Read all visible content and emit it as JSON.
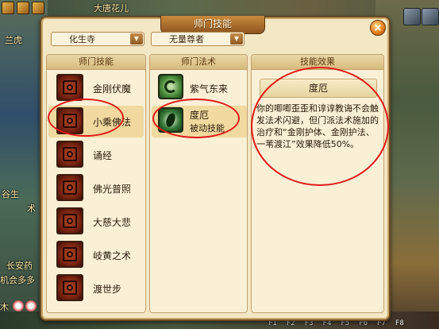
{
  "window": {
    "title": "师门技能",
    "close_symbol": "×"
  },
  "filters": {
    "faction": "化生寺",
    "skill_source": "无量尊者"
  },
  "panels": {
    "skills_header": "师门技能",
    "spells_header": "师门法术",
    "effect_header": "技能效果"
  },
  "skills": [
    {
      "label": "金刚伏魔",
      "selected": false
    },
    {
      "label": "小乘佛法",
      "selected": true
    },
    {
      "label": "诵经",
      "selected": false
    },
    {
      "label": "佛光普照",
      "selected": false
    },
    {
      "label": "大慈大悲",
      "selected": false
    },
    {
      "label": "岐黄之术",
      "selected": false
    },
    {
      "label": "渡世步",
      "selected": false
    }
  ],
  "spells": [
    {
      "label": "紫气东来",
      "sub": "",
      "selected": false
    },
    {
      "label": "度厄",
      "sub": "被动技能",
      "selected": true
    }
  ],
  "effect": {
    "title": "度厄",
    "description": "你的唧唧歪歪和谆谆教诲不会触发法术闪避，但门派法术施加的治疗和“金刚护体、金刚护法、一苇渡江”效果降低50%。"
  },
  "background": {
    "top_text": "大唐花儿",
    "left_texts": [
      "兰虎",
      "谷生",
      "术",
      "长安药",
      "机会多多",
      "木"
    ],
    "function_keys": [
      "F1",
      "F2",
      "F3",
      "F4",
      "F5",
      "F6",
      "F7",
      "F8"
    ]
  },
  "colors": {
    "highlight": "#e01818",
    "window_bg": "#f3e7c4",
    "accent": "#8c5420"
  }
}
